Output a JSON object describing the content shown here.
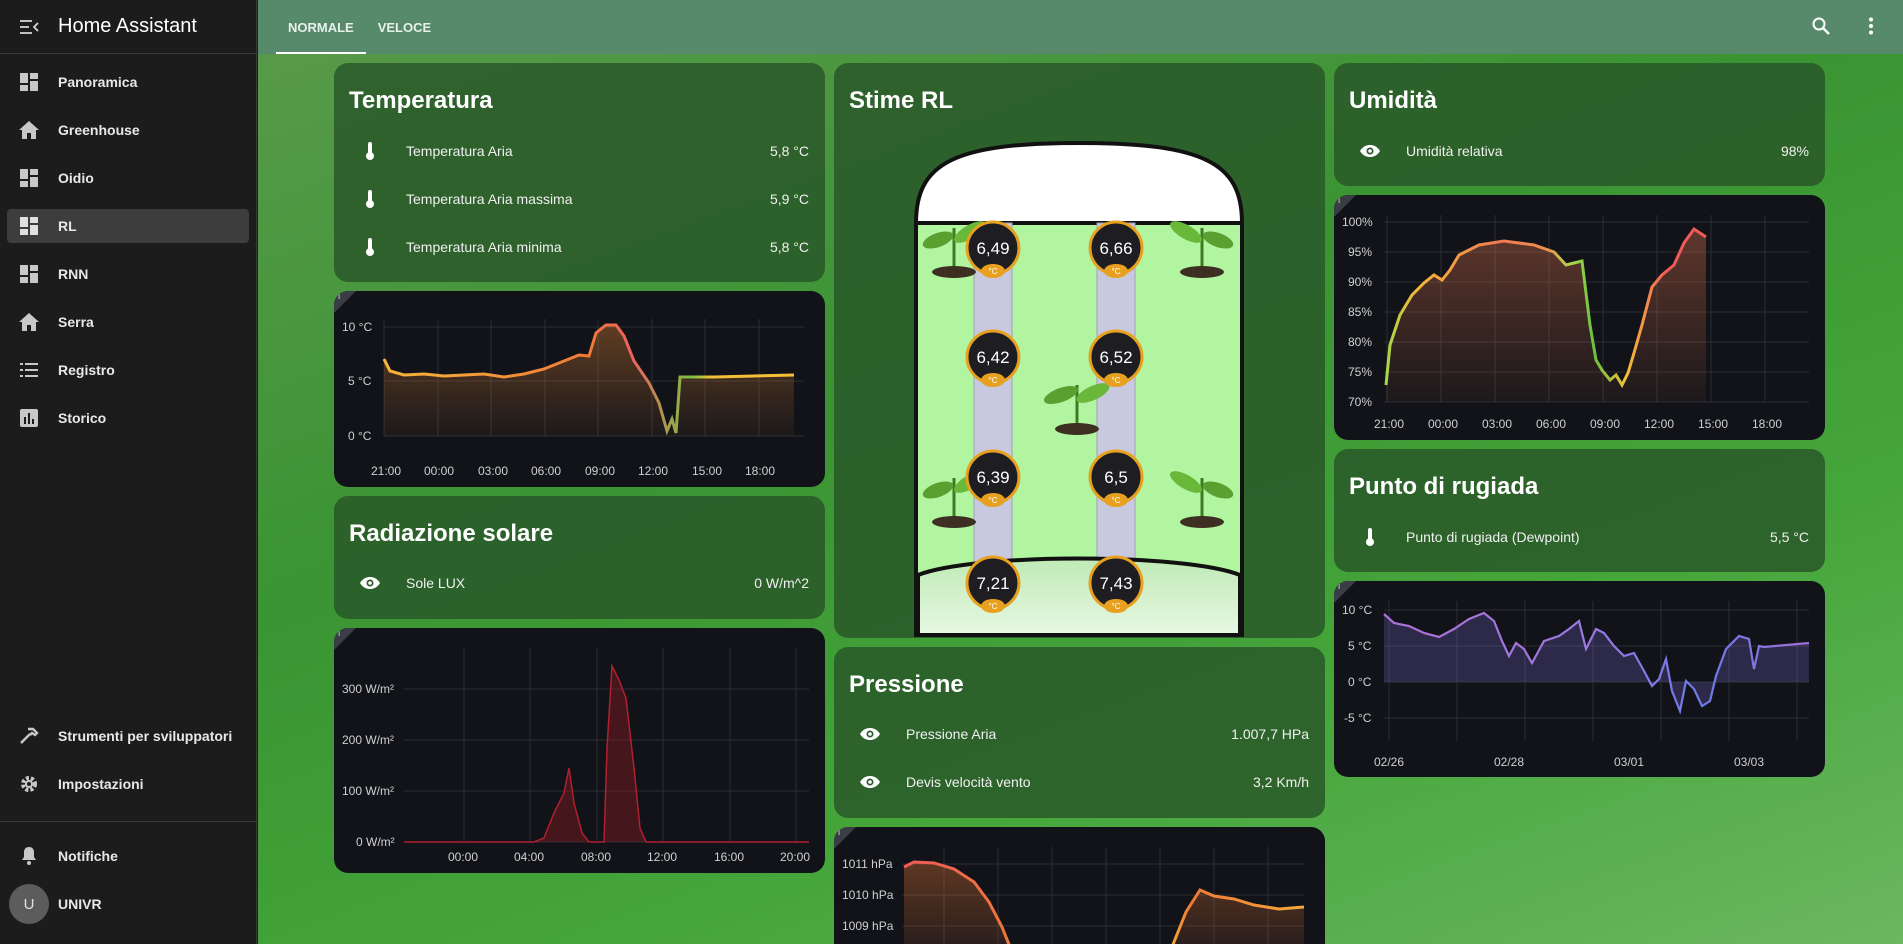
{
  "app": {
    "title": "Home Assistant"
  },
  "sidebar": {
    "items": [
      {
        "label": "Panoramica",
        "icon": "dashboard-icon"
      },
      {
        "label": "Greenhouse",
        "icon": "home-icon"
      },
      {
        "label": "Oidio",
        "icon": "dashboard-icon"
      },
      {
        "label": "RL",
        "icon": "dashboard-icon"
      },
      {
        "label": "RNN",
        "icon": "dashboard-icon"
      },
      {
        "label": "Serra",
        "icon": "home-icon"
      },
      {
        "label": "Registro",
        "icon": "list-icon"
      },
      {
        "label": "Storico",
        "icon": "chart-bar-icon"
      }
    ],
    "active": "RL",
    "tools": [
      {
        "label": "Strumenti per sviluppatori",
        "icon": "hammer-icon"
      },
      {
        "label": "Impostazioni",
        "icon": "gear-icon"
      }
    ],
    "notifications": "Notifiche",
    "user": {
      "initial": "U",
      "name": "UNIVR"
    }
  },
  "tabs": [
    "NORMALE",
    "VELOCE"
  ],
  "temperatura": {
    "title": "Temperatura",
    "rows": [
      {
        "name": "Temperatura Aria",
        "value": "5,8 °C"
      },
      {
        "name": "Temperatura Aria massima",
        "value": "5,9 °C"
      },
      {
        "name": "Temperatura Aria minima",
        "value": "5,8 °C"
      }
    ],
    "graph": {
      "y_labels": [
        "10 °C",
        "5 °C",
        "0 °C"
      ],
      "x_labels": [
        "21:00",
        "00:00",
        "03:00",
        "06:00",
        "09:00",
        "12:00",
        "15:00",
        "18:00"
      ]
    }
  },
  "radiazione": {
    "title": "Radiazione solare",
    "rows": [
      {
        "name": "Sole LUX",
        "value": "0 W/m^2"
      }
    ],
    "graph": {
      "y_labels": [
        "300 W/m²",
        "200 W/m²",
        "100 W/m²",
        "0 W/m²"
      ],
      "x_labels": [
        "00:00",
        "04:00",
        "08:00",
        "12:00",
        "16:00",
        "20:00"
      ]
    }
  },
  "stime": {
    "title": "Stime RL",
    "badges": [
      {
        "value": "6,49",
        "unit": "°C"
      },
      {
        "value": "6,66",
        "unit": "°C"
      },
      {
        "value": "6,42",
        "unit": "°C"
      },
      {
        "value": "6,52",
        "unit": "°C"
      },
      {
        "value": "6,39",
        "unit": "°C"
      },
      {
        "value": "6,5",
        "unit": "°C"
      },
      {
        "value": "7,21",
        "unit": "°C"
      },
      {
        "value": "7,43",
        "unit": "°C"
      }
    ]
  },
  "pressione": {
    "title": "Pressione",
    "rows": [
      {
        "name": "Pressione Aria",
        "value": "1.007,7 HPa"
      },
      {
        "name": "Devis velocità vento",
        "value": "3,2 Km/h"
      }
    ],
    "graph": {
      "y_labels": [
        "1011 hPa",
        "1010 hPa",
        "1009 hPa"
      ]
    }
  },
  "umidita": {
    "title": "Umidità",
    "rows": [
      {
        "name": "Umidità relativa",
        "value": "98%"
      }
    ],
    "graph": {
      "y_labels": [
        "100%",
        "95%",
        "90%",
        "85%",
        "80%",
        "75%",
        "70%"
      ],
      "x_labels": [
        "21:00",
        "00:00",
        "03:00",
        "06:00",
        "09:00",
        "12:00",
        "15:00",
        "18:00"
      ]
    }
  },
  "rugiada": {
    "title": "Punto di rugiada",
    "rows": [
      {
        "name": "Punto di rugiada (Dewpoint)",
        "value": "5,5 °C"
      }
    ],
    "graph": {
      "y_labels": [
        "10 °C",
        "5 °C",
        "0 °C",
        "-5 °C"
      ],
      "x_labels": [
        "02/26",
        "02/28",
        "03/01",
        "03/03"
      ]
    }
  },
  "info_glyph": "i",
  "colors": {
    "sidebar": "#1c1c1c",
    "topbar": "#568a6a",
    "card": "#2d5a2d",
    "graph_bg": "#111318",
    "badge_ring": "#e8a020"
  }
}
